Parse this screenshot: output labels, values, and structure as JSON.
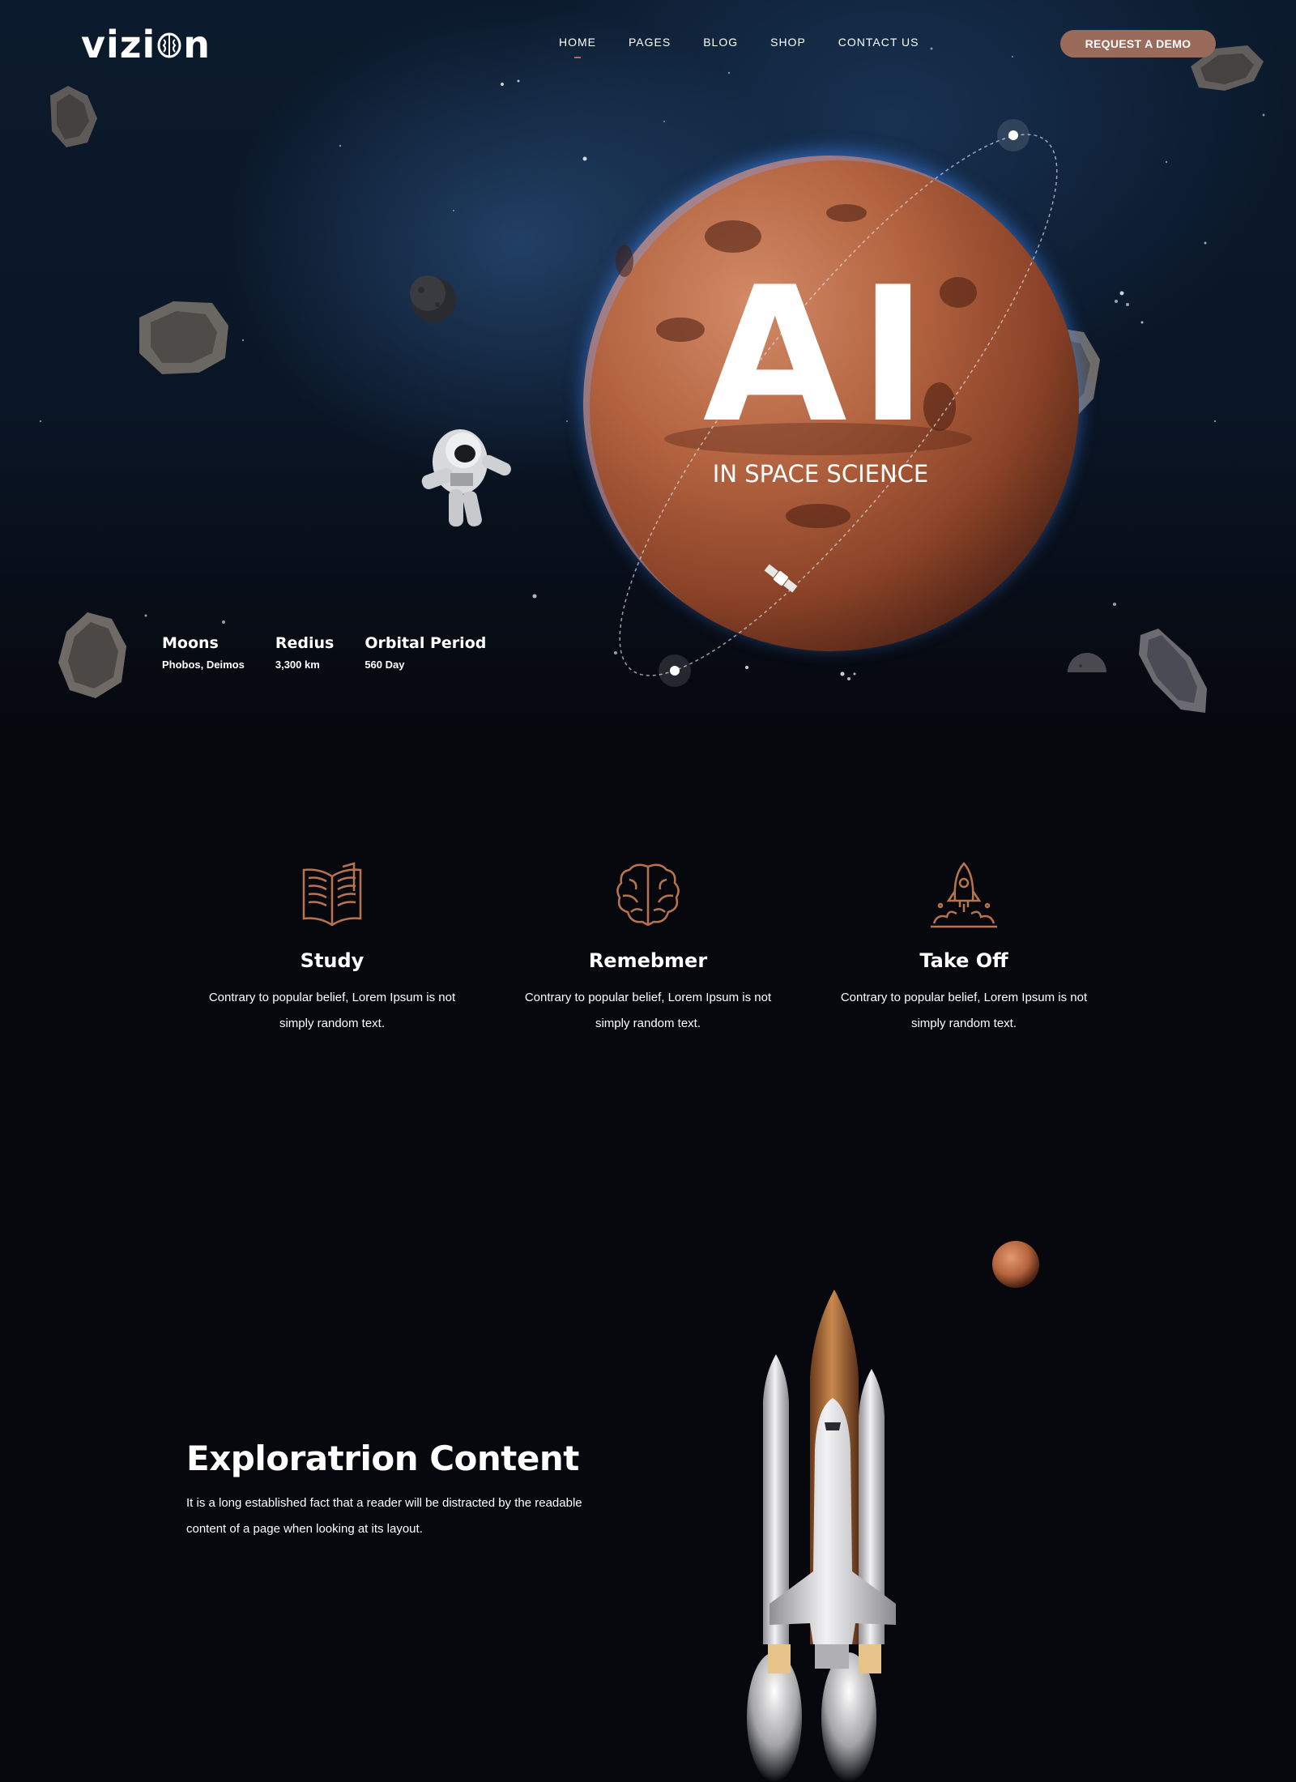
{
  "header": {
    "logo_prefix": "vizi",
    "logo_suffix": "n",
    "nav": [
      {
        "label": "HOME",
        "active": true
      },
      {
        "label": "PAGES",
        "active": false
      },
      {
        "label": "BLOG",
        "active": false
      },
      {
        "label": "SHOP",
        "active": false
      },
      {
        "label": "CONTACT US",
        "active": false
      }
    ],
    "cta_label": "REQUEST A DEMO"
  },
  "hero": {
    "headline": "AI",
    "subheadline": "IN SPACE SCIENCE",
    "stats": [
      {
        "label": "Moons",
        "value": "Phobos, Deimos"
      },
      {
        "label": "Redius",
        "value": "3,300 km"
      },
      {
        "label": "Orbital Period",
        "value": "560 Day"
      }
    ]
  },
  "features": [
    {
      "icon": "book-icon",
      "title": "Study",
      "text_line1": "Contrary to popular belief, Lorem Ipsum is not",
      "text_line2": "simply random text."
    },
    {
      "icon": "brain-icon",
      "title": "Remebmer",
      "text_line1": "Contrary to popular belief, Lorem Ipsum is not",
      "text_line2": "simply random text."
    },
    {
      "icon": "rocket-icon",
      "title": "Take Off",
      "text_line1": "Contrary to popular belief, Lorem Ipsum is not",
      "text_line2": "simply random text."
    }
  ],
  "exploration": {
    "title": "Exploratrion Content",
    "text_line1": "It is a long established fact that a reader will be distracted by the readable",
    "text_line2": "content of a page when looking at its layout."
  },
  "colors": {
    "accent": "#9a6a5a",
    "icon_stroke": "#b8734f",
    "background": "#07080e",
    "hero_sky": "#0b1a2c"
  }
}
